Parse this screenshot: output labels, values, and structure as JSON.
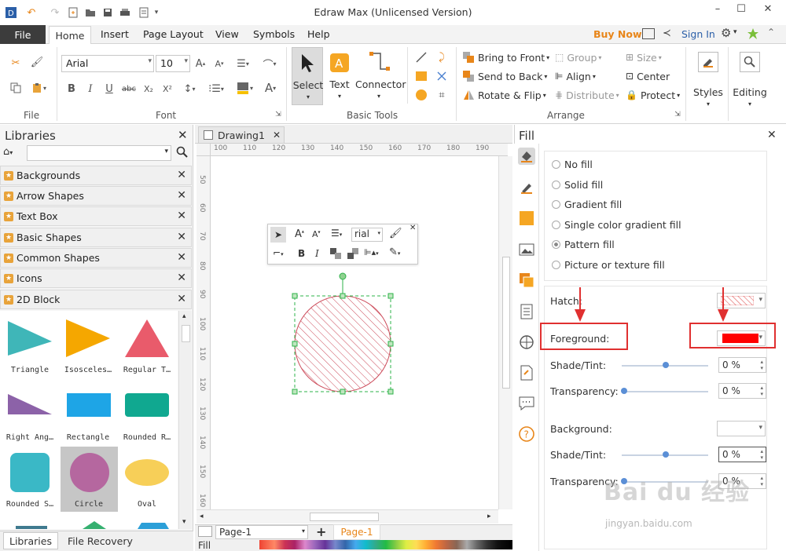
{
  "window": {
    "title": "Edraw Max (Unlicensed Version)",
    "minimize": "–",
    "maximize": "☐",
    "close": "✕"
  },
  "menu": {
    "file": "File",
    "items": [
      "Home",
      "Insert",
      "Page Layout",
      "View",
      "Symbols",
      "Help"
    ],
    "buy_now": "Buy Now",
    "sign_in": "Sign In"
  },
  "ribbon": {
    "groups": {
      "file": "File",
      "font": "Font",
      "basic_tools": "Basic Tools",
      "arrange": "Arrange"
    },
    "font_name": "Arial",
    "font_size": "10",
    "tools": {
      "select": "Select",
      "text": "Text",
      "connector": "Connector"
    },
    "arrange": {
      "bring_to_front": "Bring to Front",
      "send_to_back": "Send to Back",
      "rotate_flip": "Rotate & Flip",
      "group": "Group",
      "align": "Align",
      "distribute": "Distribute",
      "size": "Size",
      "center": "Center",
      "protect": "Protect"
    },
    "styles": "Styles",
    "editing": "Editing"
  },
  "libraries": {
    "title": "Libraries",
    "items": [
      "Backgrounds",
      "Arrow Shapes",
      "Text Box",
      "Basic Shapes",
      "Common Shapes",
      "Icons",
      "2D Block"
    ],
    "shapes": [
      "Triangle",
      "Isosceles…",
      "Regular T…",
      "Right Ang…",
      "Rectangle",
      "Rounded R…",
      "Rounded S…",
      "Circle",
      "Oval"
    ],
    "bottom_tabs": [
      "Libraries",
      "File Recovery"
    ]
  },
  "canvas": {
    "tab": "Drawing1",
    "ruler_h": [
      "100",
      "110",
      "120",
      "130",
      "140",
      "150",
      "160",
      "170",
      "180",
      "190"
    ],
    "ruler_v": [
      "50",
      "60",
      "70",
      "80",
      "90",
      "100",
      "110",
      "120",
      "130",
      "140",
      "150",
      "160"
    ],
    "mini_font": "rial",
    "page_tab": "Page-1",
    "page_label": "Page-1",
    "fill_label": "Fill"
  },
  "fill_panel": {
    "title": "Fill",
    "options": [
      "No fill",
      "Solid fill",
      "Gradient fill",
      "Single color gradient fill",
      "Pattern fill",
      "Picture or texture fill"
    ],
    "selected_option": "Pattern fill",
    "hatch_label": "Hatch:",
    "foreground_label": "Foreground:",
    "foreground_color": "#ff0000",
    "shade_tint_label": "Shade/Tint:",
    "shade_tint_value": "0 %",
    "transparency_label": "Transparency:",
    "transparency_value": "0 %",
    "background_label": "Background:",
    "bg_shade_tint_label": "Shade/Tint:",
    "bg_shade_tint_value": "0 %",
    "bg_transparency_label": "Transparency:",
    "bg_transparency_value": "0 %"
  },
  "watermark": {
    "text": "Bai du 经验",
    "url": "jingyan.baidu.com"
  },
  "colors": {
    "accent": "#e8861a",
    "annotation": "#e03030",
    "selection": "#2db34a"
  }
}
